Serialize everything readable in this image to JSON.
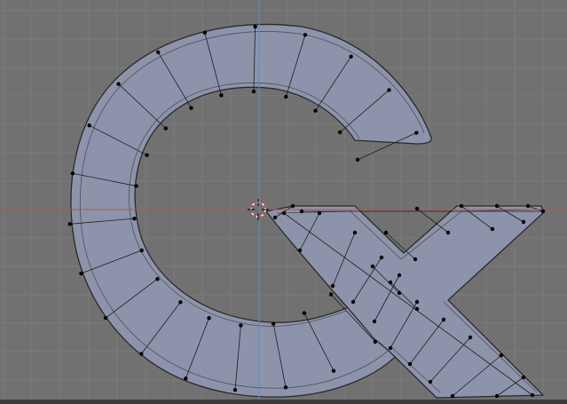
{
  "viewport": {
    "background_color": "#717171",
    "grid_color": "#7a7a7a",
    "x_axis_color": "#c0504d",
    "y_axis_color": "#5a8ec8",
    "mesh_color": "#8d93ab",
    "edge_color": "#1e1e1e",
    "vertex_color": "#000000",
    "cursor_icon": "3d-cursor-icon",
    "mode": "edit-mode"
  }
}
